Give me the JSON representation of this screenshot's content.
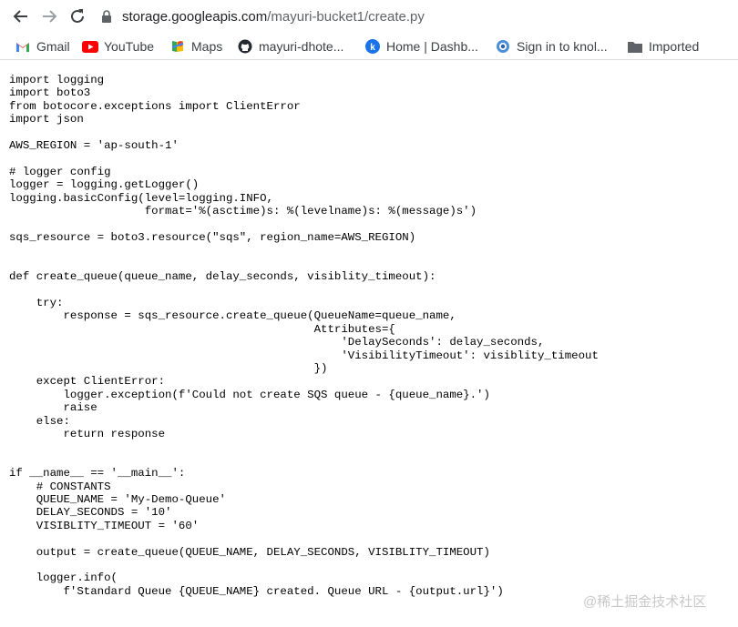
{
  "browser": {
    "url_host": "storage.googleapis.com",
    "url_path": "/mayuri-bucket1/create.py",
    "icons": {
      "back": "arrow-left-icon",
      "forward": "arrow-right-icon",
      "reload": "reload-icon",
      "lock": "lock-icon"
    }
  },
  "bookmarks": [
    {
      "label": "Gmail",
      "icon": "gmail-icon"
    },
    {
      "label": "YouTube",
      "icon": "youtube-icon"
    },
    {
      "label": "Maps",
      "icon": "maps-icon"
    },
    {
      "label": "mayuri-dhote...",
      "icon": "github-icon"
    },
    {
      "label": "Home | Dashb...",
      "icon": "knolyx-icon"
    },
    {
      "label": "Sign in to knol...",
      "icon": "knoldus-icon"
    },
    {
      "label": "Imported",
      "icon": "folder-icon"
    }
  ],
  "code": "import logging\nimport boto3\nfrom botocore.exceptions import ClientError\nimport json\n\nAWS_REGION = 'ap-south-1'\n\n# logger config\nlogger = logging.getLogger()\nlogging.basicConfig(level=logging.INFO,\n                    format='%(asctime)s: %(levelname)s: %(message)s')\n\nsqs_resource = boto3.resource(\"sqs\", region_name=AWS_REGION)\n\n\ndef create_queue(queue_name, delay_seconds, visiblity_timeout):\n\n    try:\n        response = sqs_resource.create_queue(QueueName=queue_name,\n                                             Attributes={\n                                                 'DelaySeconds': delay_seconds,\n                                                 'VisibilityTimeout': visiblity_timeout\n                                             })\n    except ClientError:\n        logger.exception(f'Could not create SQS queue - {queue_name}.')\n        raise\n    else:\n        return response\n\n\nif __name__ == '__main__':\n    # CONSTANTS\n    QUEUE_NAME = 'My-Demo-Queue'\n    DELAY_SECONDS = '10'\n    VISIBLITY_TIMEOUT = '60'\n\n    output = create_queue(QUEUE_NAME, DELAY_SECONDS, VISIBLITY_TIMEOUT)\n\n    logger.info(\n        f'Standard Queue {QUEUE_NAME} created. Queue URL - {output.url}')",
  "watermark": "@稀土掘金技术社区",
  "colors": {
    "youtube": "#ff0000",
    "gmail_red": "#ea4335",
    "knolyx_blue": "#1a73e8",
    "folder": "#5f6368"
  }
}
